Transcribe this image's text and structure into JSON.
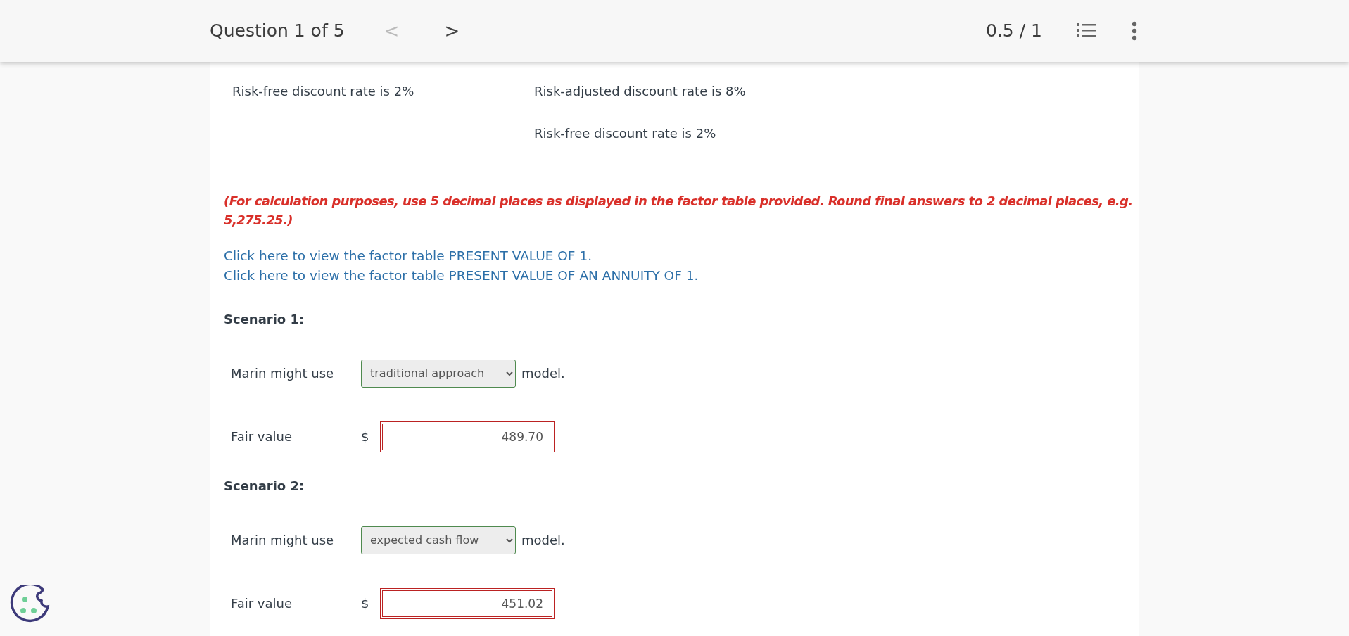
{
  "header": {
    "title": "Question 1 of 5",
    "prev": {
      "label": "<",
      "disabled": true
    },
    "next": {
      "label": ">",
      "disabled": false
    },
    "score": "0.5 / 1"
  },
  "facts": [
    [
      "Risk-free discount rate is 2%"
    ],
    [
      "Risk-adjusted discount rate is 8%",
      "Risk-free discount rate is 2%"
    ]
  ],
  "note": "(For calculation purposes, use 5 decimal places as displayed in the factor table provided. Round final answers to 2 decimal places, e.g. 5,275.25.)",
  "links": [
    "Click here to view the factor table PRESENT VALUE OF 1.",
    "Click here to view the factor table PRESENT VALUE OF AN ANNUITY OF 1."
  ],
  "scenarios": [
    {
      "title": "Scenario 1:",
      "model_label": "Marin might use",
      "model": {
        "value": "traditional approach",
        "correct": true
      },
      "model_suffix": "model.",
      "fair_label": "Fair value",
      "currency": "$",
      "fair": {
        "value": "489.70",
        "correct": false
      }
    },
    {
      "title": "Scenario 2:",
      "model_label": "Marin might use",
      "model": {
        "value": "expected cash flow",
        "correct": true
      },
      "model_suffix": "model.",
      "fair_label": "Fair value",
      "currency": "$",
      "fair": {
        "value": "451.02",
        "correct": false
      }
    }
  ]
}
